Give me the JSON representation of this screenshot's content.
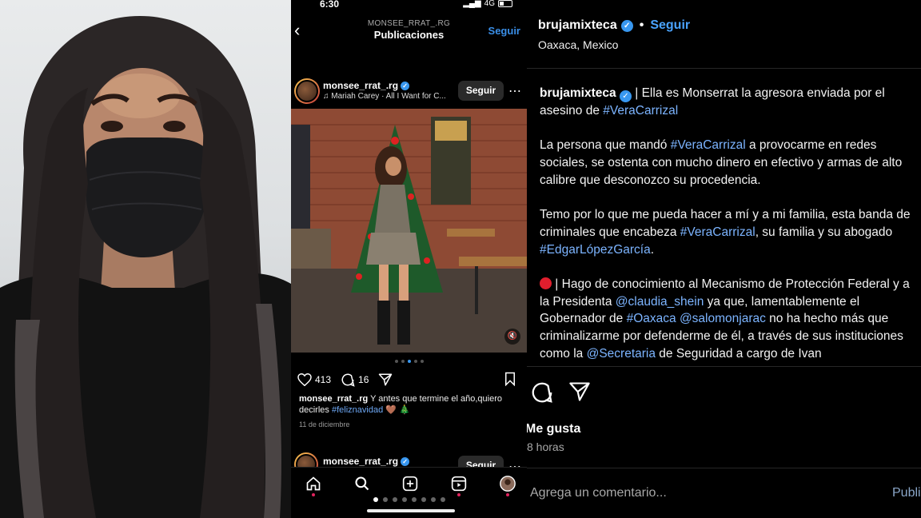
{
  "phone": {
    "status_time": "6:30",
    "network": "4G",
    "header_username": "MONSEE_RRAT_.RG",
    "header_title": "Publicaciones",
    "follow_top": "Seguir",
    "post": {
      "username": "monsee_rrat_.rg",
      "music": "♫ Mariah Carey · All I Want for C...",
      "follow": "Seguir",
      "likes": "413",
      "comments": "16",
      "caption_user": "monsee_rrat_.rg",
      "caption_text": "Y antes que termine el año,quiero decirles",
      "caption_hashtag": "#feliznavidad",
      "caption_emoji": "🤎 🎄",
      "date": "11 de diciembre"
    },
    "post2": {
      "username": "monsee_rrat_.rg",
      "follow": "Seguir"
    }
  },
  "panel": {
    "username": "brujamixteca",
    "follow": "Seguir",
    "location": "Oaxaca, Mexico",
    "caption_user": "brujamixteca",
    "p1_text": " | Ella es Monserrat la agresora enviada por el asesino de ",
    "p1_tag": "#VeraCarrizal",
    "p2_a": "La persona que mandó ",
    "p2_tag": "#VeraCarrizal",
    "p2_b": " a provocarme en redes sociales, se ostenta con mucho dinero en efectivo y armas de alto calibre que desconozco su procedencia.",
    "p3_a": "Temo por lo que me pueda hacer a mí y a mi familia, esta banda de criminales que encabeza ",
    "p3_tag1": "#VeraCarrizal",
    "p3_b": ", su familia y su abogado ",
    "p3_tag2": "#EdgarLópezGarcía",
    "p3_c": ".",
    "p4_a": " | Hago de conocimiento al Mecanismo de Protección Federal y a la Presidenta ",
    "p4_mention1": "@claudia_shein",
    "p4_b": " ya que, lamentablemente el Gobernador de ",
    "p4_tag": "#Oaxaca",
    "p4_c": " ",
    "p4_mention2": "@salomonjarac",
    "p4_d": " no ha hecho más que criminalizarme por defenderme de él, a través de sus instituciones como la ",
    "p4_mention3": "@Secretaria",
    "p4_e": " de Seguridad a cargo de Ivan",
    "likes_label": "Me gusta",
    "time": "8 horas",
    "comment_placeholder": "Agrega un comentario...",
    "publish": "Publi"
  },
  "colors": {
    "accent_blue": "#3a8fe8",
    "hashtag_blue": "#7cb4ff",
    "verified_blue": "#3897f0",
    "alert_red": "#e01e2d"
  },
  "icons": [
    "back-icon",
    "verified-icon",
    "music-icon",
    "more-icon",
    "heart-icon",
    "comment-icon",
    "share-icon",
    "bookmark-icon",
    "home-icon",
    "search-icon",
    "create-icon",
    "reels-icon",
    "profile-icon",
    "mute-icon"
  ]
}
